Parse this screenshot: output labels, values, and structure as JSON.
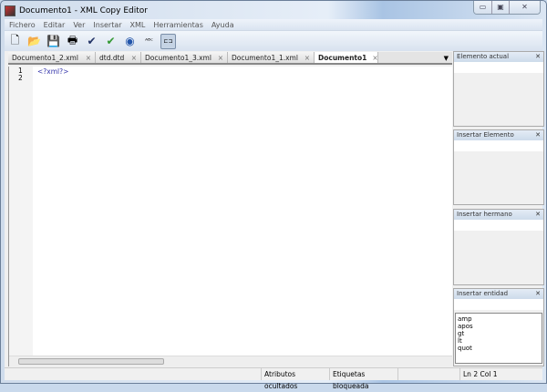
{
  "window": {
    "title": "Documento1 - XML Copy Editor",
    "minimize": "▭",
    "maximize": "▣",
    "close": "✕"
  },
  "menu": [
    "Fichero",
    "Editar",
    "Ver",
    "Insertar",
    "XML",
    "Herramientas",
    "Ayuda"
  ],
  "toolbar": [
    {
      "icon": "new-file-icon",
      "glyph": "🗋"
    },
    {
      "icon": "open-folder-icon",
      "glyph": "📂"
    },
    {
      "icon": "save-icon",
      "glyph": "💾"
    },
    {
      "icon": "print-icon",
      "glyph": "🖶"
    },
    {
      "icon": "check-wellformed-icon",
      "glyph": "✔"
    },
    {
      "icon": "validate-icon",
      "glyph": "✔"
    },
    {
      "icon": "browser-icon",
      "glyph": "◉"
    },
    {
      "icon": "spellcheck-icon",
      "glyph": "ᴬᴮᶜ"
    },
    {
      "icon": "tag-lock-icon",
      "glyph": "⊏⊐"
    }
  ],
  "tabs": [
    {
      "label": "Documento1_2.xml"
    },
    {
      "label": "dtd.dtd"
    },
    {
      "label": "Documento1_3.xml"
    },
    {
      "label": "Documento1_1.xml"
    },
    {
      "label": "Documento1",
      "active": true
    }
  ],
  "tab_close": "×",
  "tab_menu": "▼",
  "editor": {
    "line_numbers": [
      "1",
      "2"
    ],
    "lines": [
      "<?xml?>",
      ""
    ]
  },
  "panels": [
    {
      "title": "Elemento actual"
    },
    {
      "title": "Insertar Elemento"
    },
    {
      "title": "Insertar hermano"
    },
    {
      "title": "Insertar entidad",
      "items": [
        "amp",
        "apos",
        "gt",
        "lt",
        "quot"
      ]
    }
  ],
  "panel_close": "✕",
  "status": {
    "attrs": "Atributos ocultados",
    "tags": "Etiquetas bloqueada",
    "position": "Ln 2 Col 1"
  }
}
